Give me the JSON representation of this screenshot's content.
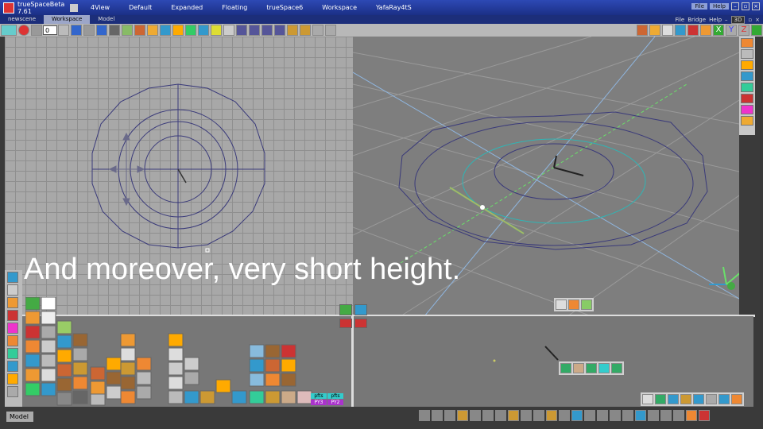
{
  "app": {
    "title": "trueSpaceBeta 7.61",
    "layouts": [
      "4View",
      "Default",
      "Expanded",
      "Floating",
      "trueSpace6",
      "Workspace",
      "YafaRay4tS"
    ],
    "menus_right": [
      "File",
      "Help"
    ]
  },
  "docbar": {
    "tabs": [
      "newscene",
      "Workspace",
      "Model"
    ],
    "right_menus": [
      "File",
      "Bridge",
      "Help"
    ],
    "mode_label": "3D"
  },
  "toolbar": {
    "frame_value": "0"
  },
  "caption": "And moreover, very short height.",
  "status": {
    "mode": "Model"
  },
  "layer_buttons": {
    "top": [
      "pfts",
      "pfts"
    ],
    "bottom": [
      "PY3",
      "PY2"
    ]
  },
  "colors": {
    "titlebar": "#2d49b4",
    "viewport_top": "#a8a8a8",
    "viewport_persp": "#7e7e7e",
    "circle_stroke": "#3a3a7a",
    "cyan_circle": "#2fb5b5",
    "green_axis": "#6ae06a"
  },
  "icons": [
    "undo-icon",
    "record-icon",
    "play-icon",
    "stop-icon",
    "axis-x-icon",
    "axis-y-icon",
    "axis-z-icon",
    "grid-icon"
  ]
}
